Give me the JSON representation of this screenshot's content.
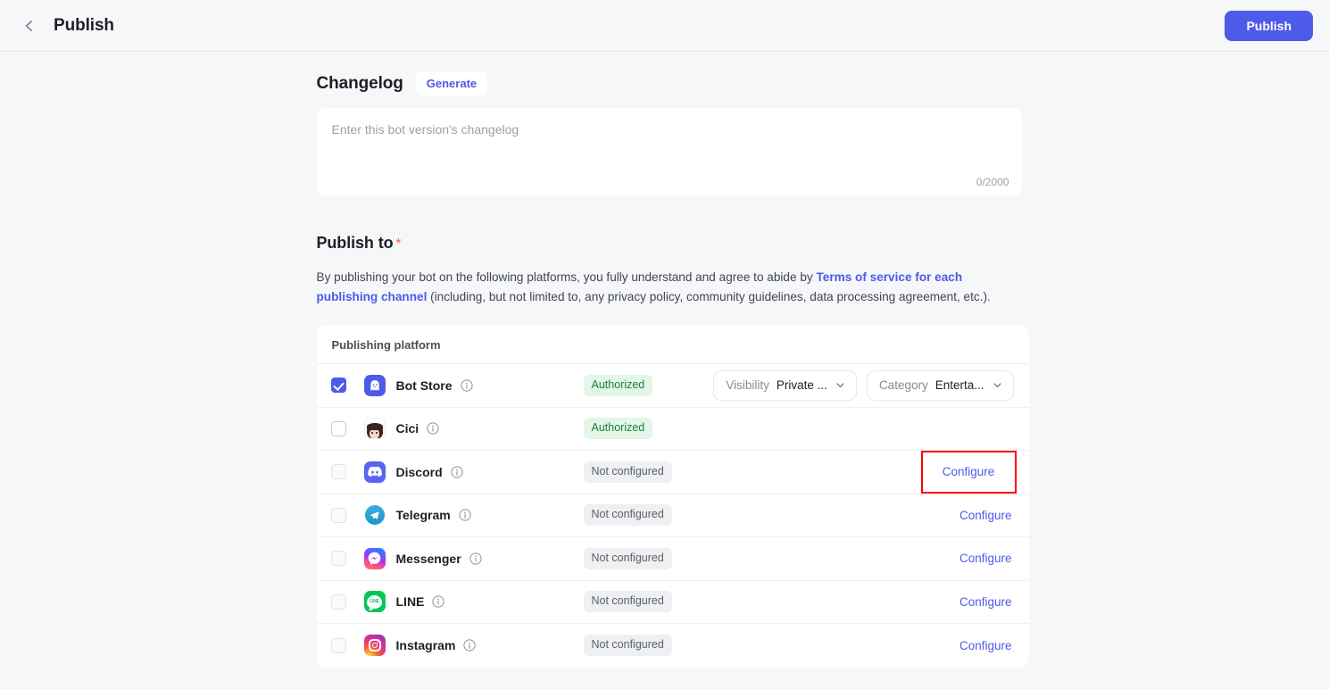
{
  "header": {
    "back_icon": "chevron-left-icon",
    "title": "Publish",
    "publish_button": "Publish"
  },
  "changelog": {
    "title": "Changelog",
    "generate_button": "Generate",
    "placeholder": "Enter this bot version's changelog",
    "value": "",
    "char_count": "0/2000"
  },
  "publish_to": {
    "title": "Publish to",
    "required_marker": "*",
    "description_before": "By publishing your bot on the following platforms, you fully understand and agree to abide by ",
    "link_text": "Terms of service for each publishing channel",
    "description_after": " (including, but not limited to, any privacy policy, community guidelines, data processing agreement, etc.)."
  },
  "platform_table": {
    "header": "Publishing platform",
    "rows": [
      {
        "name": "Bot Store",
        "icon": "bot-store-icon",
        "checked": true,
        "checkbox_state": "checked",
        "status": "Authorized",
        "status_type": "authorized",
        "selectors": [
          {
            "label": "Visibility",
            "value": "Private ..."
          },
          {
            "label": "Category",
            "value": "Enterta..."
          }
        ],
        "action": null,
        "highlighted": false
      },
      {
        "name": "Cici",
        "icon": "cici-avatar-icon",
        "checked": false,
        "checkbox_state": "unchecked",
        "status": "Authorized",
        "status_type": "authorized",
        "selectors": [],
        "action": null,
        "highlighted": false
      },
      {
        "name": "Discord",
        "icon": "discord-icon",
        "checked": false,
        "checkbox_state": "disabled",
        "status": "Not configured",
        "status_type": "not-configured",
        "selectors": [],
        "action": "Configure",
        "highlighted": true
      },
      {
        "name": "Telegram",
        "icon": "telegram-icon",
        "checked": false,
        "checkbox_state": "disabled",
        "status": "Not configured",
        "status_type": "not-configured",
        "selectors": [],
        "action": "Configure",
        "highlighted": false
      },
      {
        "name": "Messenger",
        "icon": "messenger-icon",
        "checked": false,
        "checkbox_state": "disabled",
        "status": "Not configured",
        "status_type": "not-configured",
        "selectors": [],
        "action": "Configure",
        "highlighted": false
      },
      {
        "name": "LINE",
        "icon": "line-icon",
        "checked": false,
        "checkbox_state": "disabled",
        "status": "Not configured",
        "status_type": "not-configured",
        "selectors": [],
        "action": "Configure",
        "highlighted": false
      },
      {
        "name": "Instagram",
        "icon": "instagram-icon",
        "checked": false,
        "checkbox_state": "disabled",
        "status": "Not configured",
        "status_type": "not-configured",
        "selectors": [],
        "action": "Configure",
        "highlighted": false
      }
    ]
  },
  "colors": {
    "accent": "#4e5ae8",
    "page_bg": "#f6f7f9",
    "card_bg": "#ffffff",
    "badge_ok_bg": "#e3f6e7",
    "badge_ok_text": "#1c7f3c",
    "badge_none_bg": "#eef0f2",
    "badge_none_text": "#5b6069",
    "required_star": "#ff5a3c",
    "highlight_box": "#ff0000"
  }
}
